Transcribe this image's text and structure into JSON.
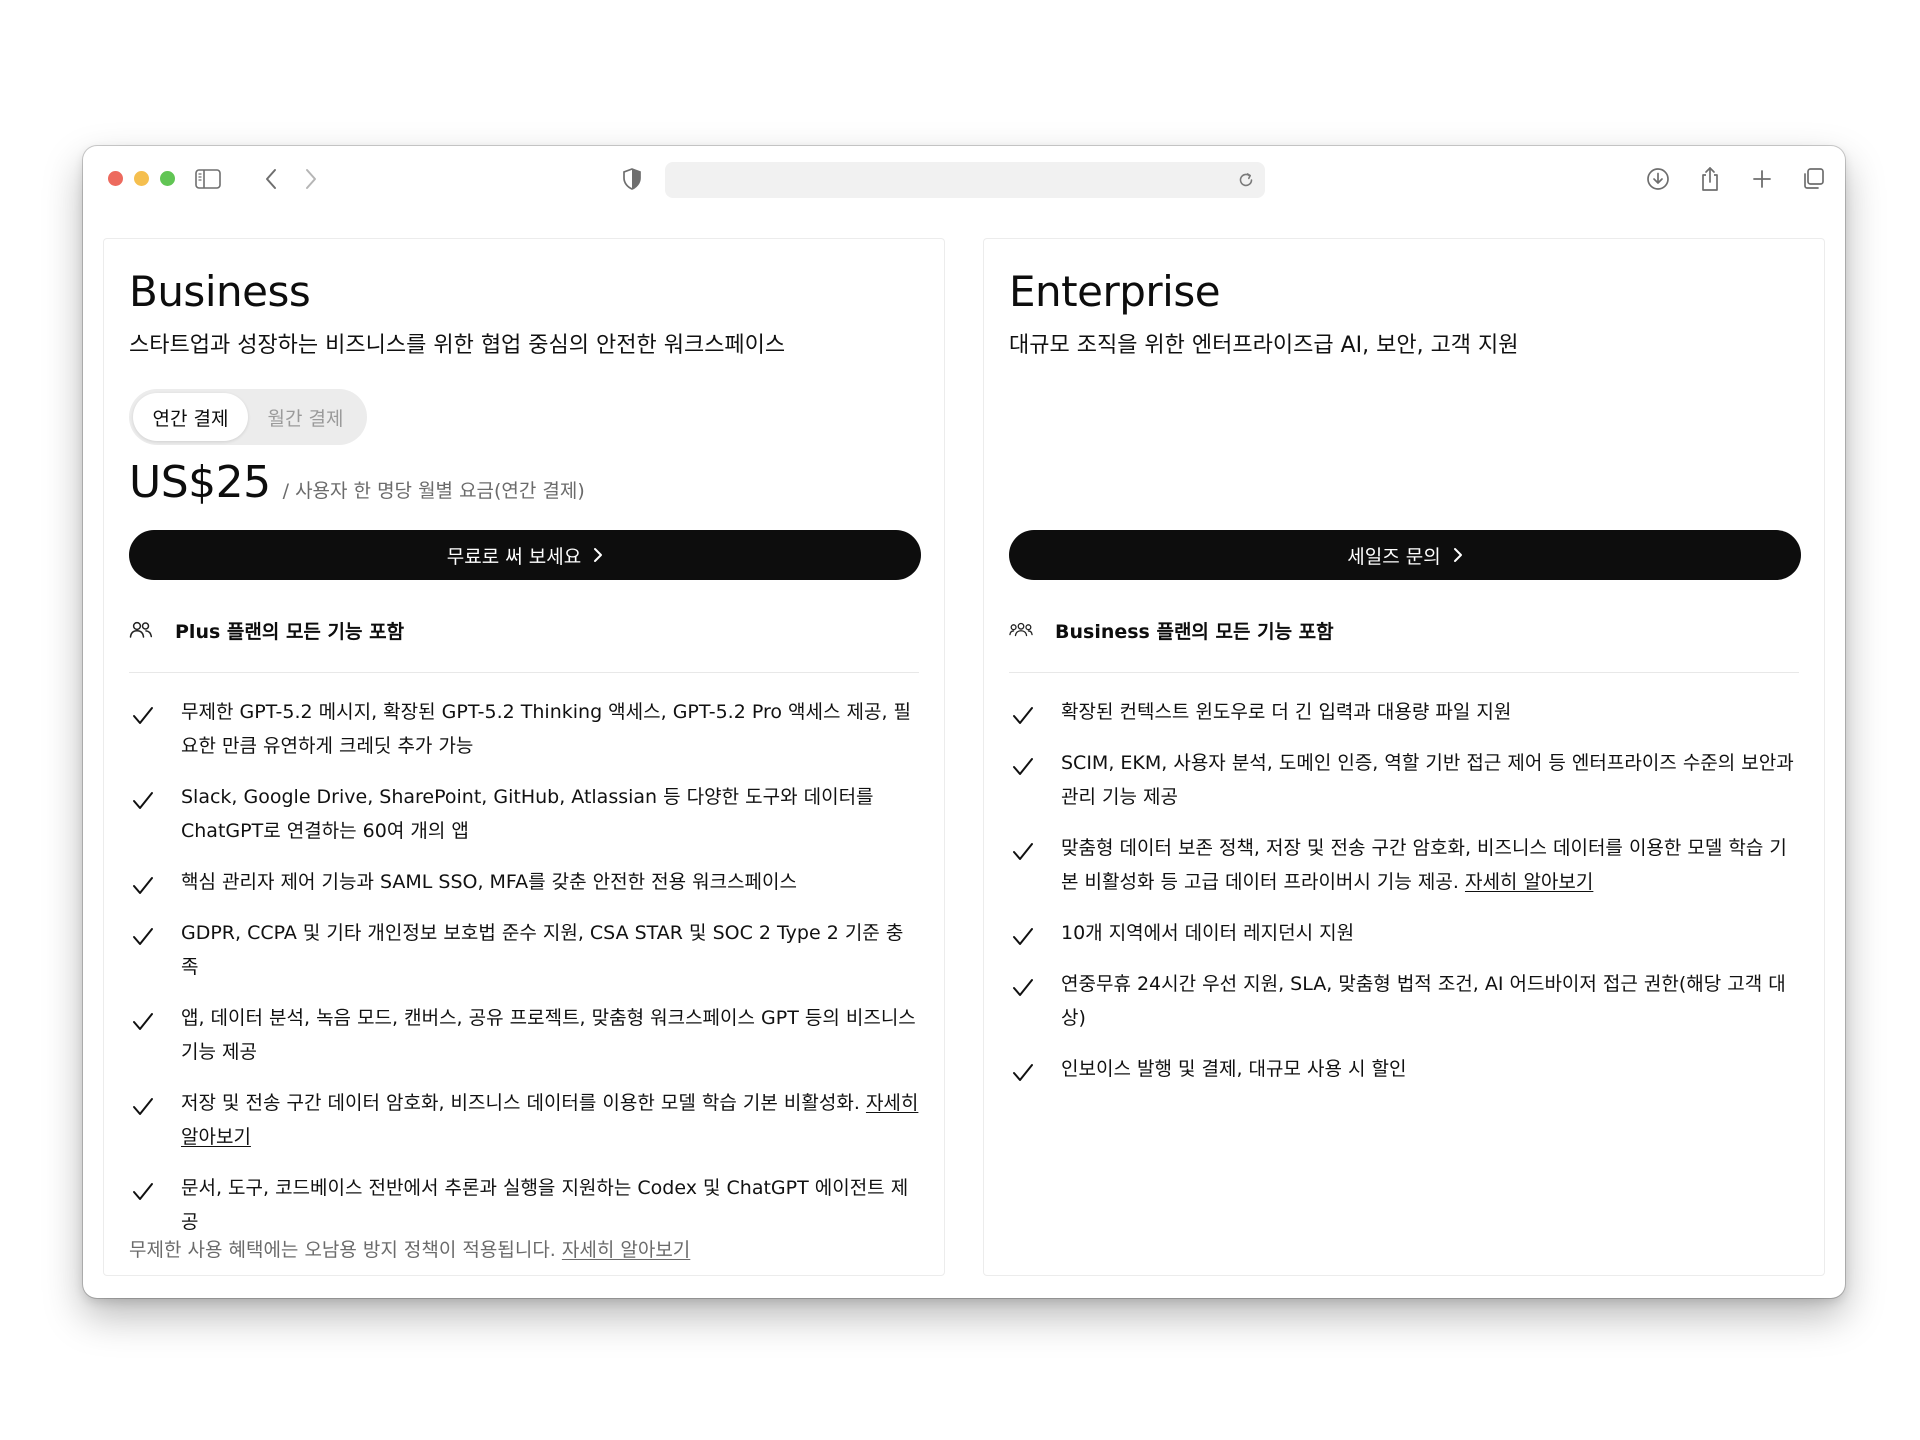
{
  "browser": {
    "address": "",
    "traffic_light_colors": [
      "#ed6a5e",
      "#f5bf4f",
      "#61c554"
    ]
  },
  "business": {
    "title": "Business",
    "subtitle": "스타트업과 성장하는 비즈니스를 위한 협업 중심의 안전한 워크스페이스",
    "billing_toggle": {
      "options": [
        "연간 결제",
        "월간 결제"
      ],
      "selected": "연간 결제"
    },
    "price": "US$25",
    "price_note": "/ 사용자 한 명당 월별 요금(연간 결제)",
    "cta_label": "무료로 써 보세요",
    "includes_label": "Plus 플랜의 모든 기능 포함",
    "features": [
      {
        "text": "무제한 GPT-5.2 메시지, 확장된 GPT-5.2 Thinking 액세스, GPT-5.2 Pro 액세스 제공, 필요한 만큼 유연하게 크레딧 추가 가능",
        "link": ""
      },
      {
        "text": "Slack, Google Drive, SharePoint, GitHub, Atlassian 등 다양한 도구와 데이터를 ChatGPT로 연결하는 60여 개의 앱",
        "link": ""
      },
      {
        "text": "핵심 관리자 제어 기능과 SAML SSO, MFA를 갖춘 안전한 전용 워크스페이스",
        "link": ""
      },
      {
        "text": "GDPR, CCPA 및 기타 개인정보 보호법 준수 지원, CSA STAR 및 SOC 2 Type 2 기준 충족",
        "link": ""
      },
      {
        "text": "앱, 데이터 분석, 녹음 모드, 캔버스, 공유 프로젝트, 맞춤형 워크스페이스 GPT 등의 비즈니스 기능 제공",
        "link": ""
      },
      {
        "text": "저장 및 전송 구간 데이터 암호화, 비즈니스 데이터를 이용한 모델 학습 기본 비활성화.",
        "link": "자세히 알아보기"
      },
      {
        "text": "문서, 도구, 코드베이스 전반에서 추론과 실행을 지원하는 Codex 및 ChatGPT 에이전트 제공",
        "link": ""
      }
    ],
    "footnote": "무제한 사용 혜택에는 오남용 방지 정책이 적용됩니다.",
    "footnote_link": "자세히 알아보기"
  },
  "enterprise": {
    "title": "Enterprise",
    "subtitle": "대규모 조직을 위한 엔터프라이즈급 AI, 보안, 고객 지원",
    "cta_label": "세일즈 문의",
    "includes_label": "Business 플랜의 모든 기능 포함",
    "features": [
      {
        "text": "확장된 컨텍스트 윈도우로 더 긴 입력과 대용량 파일 지원",
        "link": ""
      },
      {
        "text": "SCIM, EKM, 사용자 분석, 도메인 인증, 역할 기반 접근 제어 등 엔터프라이즈 수준의 보안과 관리 기능 제공",
        "link": ""
      },
      {
        "text": "맞춤형 데이터 보존 정책, 저장 및 전송 구간 암호화, 비즈니스 데이터를 이용한 모델 학습 기본 비활성화 등 고급 데이터 프라이버시 기능 제공.",
        "link": "자세히 알아보기"
      },
      {
        "text": "10개 지역에서 데이터 레지던시 지원",
        "link": ""
      },
      {
        "text": "연중무휴 24시간 우선 지원, SLA, 맞춤형 법적 조건, AI 어드바이저 접근 권한(해당 고객 대상)",
        "link": ""
      },
      {
        "text": "인보이스 발행 및 결제, 대규모 사용 시 할인",
        "link": ""
      }
    ]
  }
}
